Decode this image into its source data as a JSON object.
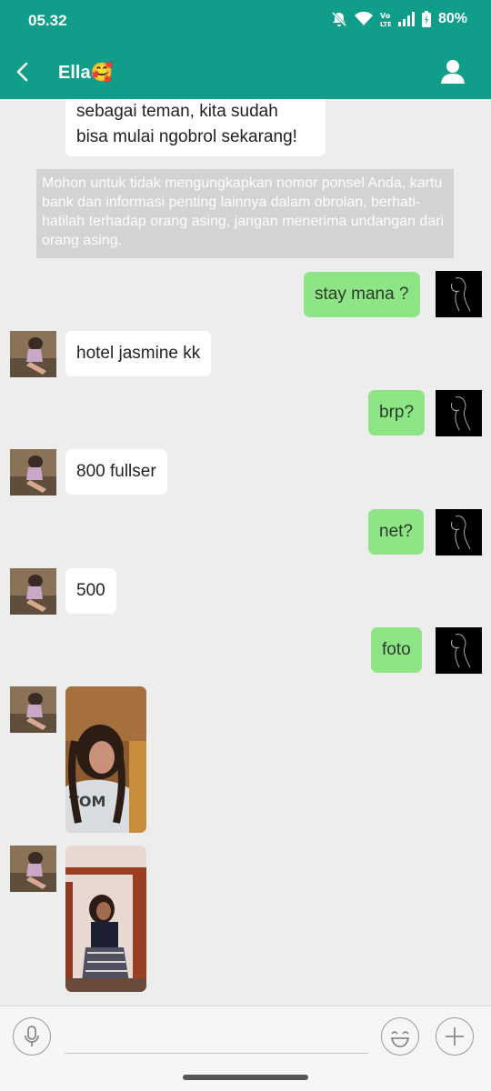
{
  "status": {
    "time": "05.32",
    "battery": "80%"
  },
  "header": {
    "title": "Ella",
    "title_emoji": "🥰"
  },
  "messages": {
    "first_partial_line1": "sebagai teman, kita sudah",
    "first_partial_line2": "bisa mulai ngobrol sekarang!",
    "notice": "Mohon untuk tidak  mengungkapkan nomor ponsel Anda, kartu bank dan informasi penting lainnya dalam obrolan, berhati-hatilah terhadap orang asing, jangan menerima undangan dari orang asing.",
    "m1_me": "stay mana ?",
    "m2_her": "hotel jasmine kk",
    "m3_me": "brp?",
    "m4_her": "800 fullser",
    "m5_me": "net?",
    "m6_her": "500",
    "m7_me": "foto"
  },
  "input": {
    "placeholder": ""
  },
  "icons": {
    "back": "back-arrow-icon",
    "profile": "person-icon",
    "mic": "microphone-icon",
    "emoji": "smiley-icon",
    "add": "plus-icon"
  },
  "colors": {
    "header": "#109d8a",
    "my_bubble": "#8ee586",
    "their_bubble": "#ffffff",
    "background": "#ededed"
  }
}
